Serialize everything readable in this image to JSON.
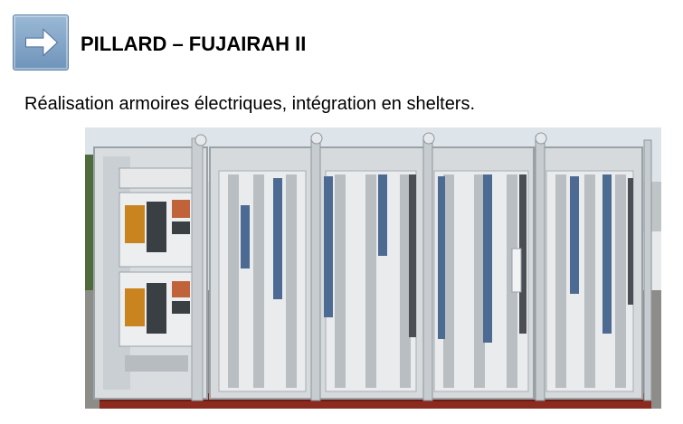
{
  "slide": {
    "title": "PILLARD – FUJAIRAH II",
    "subtitle": "Réalisation armoires électriques, intégration en shelters.",
    "nav_icon": "arrow-right-icon",
    "photo_subject": "electrical-cabinets-photo"
  },
  "colors": {
    "icon_bg": "#7ea2c7",
    "cabinet_frame": "#d9dde0",
    "pallet": "#8b2a1e"
  }
}
